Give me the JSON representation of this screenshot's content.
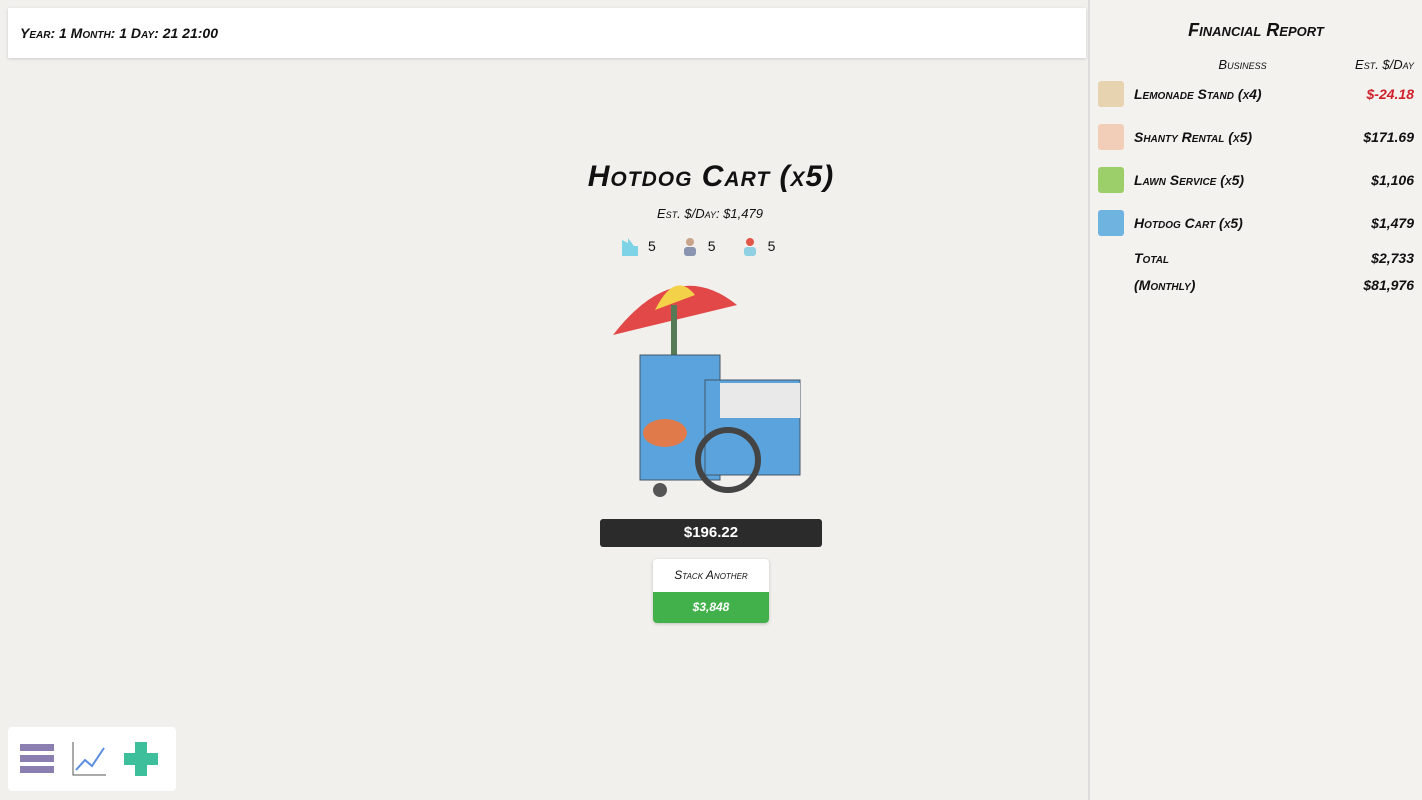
{
  "topbar": {
    "datetime": "Year: 1 Month: 1 Day: 21 21:00"
  },
  "business": {
    "title": "Hotdog Cart (x5)",
    "est": "Est. $/Day: $1,479",
    "stats": [
      {
        "icon": "building-icon",
        "value": "5"
      },
      {
        "icon": "worker-icon",
        "value": "5"
      },
      {
        "icon": "manager-icon",
        "value": "5"
      }
    ],
    "progress_label": "$196.22",
    "buy_label": "Stack Another",
    "buy_price": "$3,848"
  },
  "report": {
    "title": "Financial Report",
    "col_business": "Business",
    "col_est": "Est. $/Day",
    "rows": [
      {
        "name": "Lemonade Stand (x4)",
        "value": "$-24.18",
        "color": "#d0202a",
        "icon_color": "#e8d3b0"
      },
      {
        "name": "Shanty Rental (x5)",
        "value": "$171.69",
        "color": "#111111",
        "icon_color": "#f2cdb7"
      },
      {
        "name": "Lawn Service (x5)",
        "value": "$1,106",
        "color": "#111111",
        "icon_color": "#9ccf6a"
      },
      {
        "name": "Hotdog Cart (x5)",
        "value": "$1,479",
        "color": "#111111",
        "icon_color": "#6fb3e0"
      }
    ],
    "total_label": "Total",
    "total_value": "$2,733",
    "monthly_label": "(Monthly)",
    "monthly_value": "$81,976"
  },
  "colors": {
    "accent_green": "#43b14b",
    "negative": "#d0202a"
  }
}
